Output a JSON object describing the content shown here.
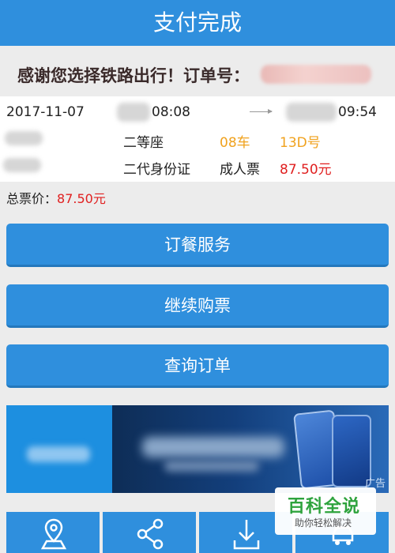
{
  "header": {
    "title": "支付完成"
  },
  "thanks": {
    "text": "感谢您选择铁路出行！订单号："
  },
  "ticket": {
    "date": "2017-11-07",
    "depart_time": "08:08",
    "arrive_time": "09:54",
    "seat_class": "二等座",
    "car": "08车",
    "seat_no": "13D号",
    "id_type": "二代身份证",
    "ticket_type": "成人票",
    "price": "87.50元"
  },
  "total": {
    "label": "总票价：",
    "value": "87.50元"
  },
  "buttons": {
    "meal": "订餐服务",
    "buy_more": "继续购票",
    "query_order": "查询订单"
  },
  "ad": {
    "tag": "广告"
  },
  "bottom_bar": {
    "icons": [
      "map-location-icon",
      "share-icon",
      "download-icon",
      "car-icon"
    ]
  },
  "watermark": {
    "title": "百科全说",
    "subtitle": "助你轻松解决"
  },
  "colors": {
    "primary": "#2f8fdd",
    "orange": "#f0a21e",
    "red": "#e02020"
  }
}
